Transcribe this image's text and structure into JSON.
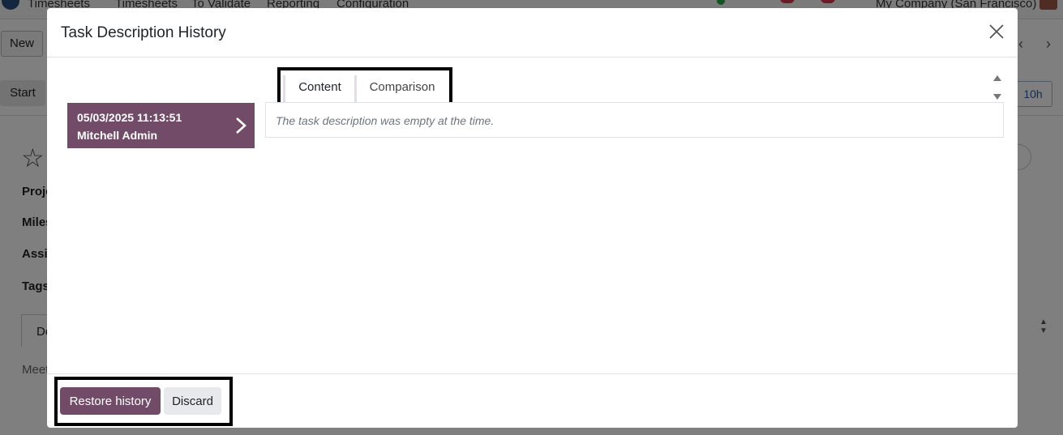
{
  "background": {
    "nav": {
      "app_name": "Timesheets",
      "items": [
        "Timesheets",
        "To Validate",
        "Reporting",
        "Configuration"
      ],
      "company": "My Company (San Francisco)"
    },
    "new_label": "New",
    "start_label": "Start",
    "hours_label": "10h",
    "field_labels": [
      "Proje",
      "Miles",
      "Assig",
      "Tags"
    ],
    "tab_label": "De",
    "meet_label": "Meet"
  },
  "modal": {
    "title": "Task Description History",
    "history": {
      "date": "05/03/2025 11:13:51",
      "user": "Mitchell Admin"
    },
    "tabs": [
      {
        "label": "Content"
      },
      {
        "label": "Comparison"
      }
    ],
    "empty_message": "The task description was empty at the time.",
    "footer": {
      "restore_label": "Restore history",
      "discard_label": "Discard"
    }
  },
  "colors": {
    "primary": "#714b67",
    "overlay": "rgba(0,0,0,0.5)",
    "highlight_border": "#000000"
  },
  "icons": [
    "close-icon",
    "chevron-right-icon",
    "scroll-arrows-icon",
    "star-icon"
  ]
}
